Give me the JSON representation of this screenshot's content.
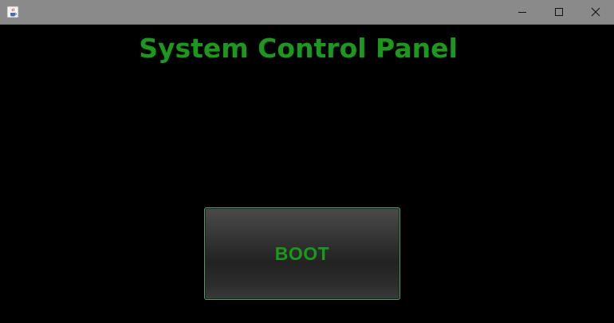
{
  "window": {
    "icons": {
      "app": "java-cup-icon",
      "minimize": "minimize-icon",
      "maximize": "maximize-icon",
      "close": "close-icon"
    }
  },
  "panel": {
    "title": "System Control Panel",
    "boot_label": "BOOT"
  },
  "colors": {
    "background": "#000000",
    "accent_text": "#1a9a1a",
    "titlebar": "#8a8a8a",
    "button_border": "#4fa06a"
  }
}
